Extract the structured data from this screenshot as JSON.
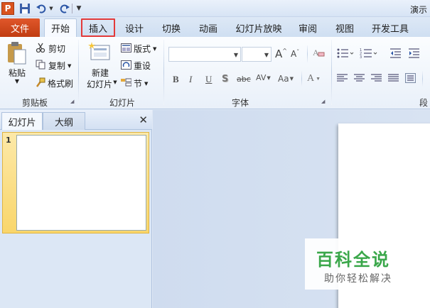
{
  "app": {
    "logo_letter": "P",
    "title": "演示"
  },
  "tabs": [
    {
      "label": "文件"
    },
    {
      "label": "开始"
    },
    {
      "label": "插入"
    },
    {
      "label": "设计"
    },
    {
      "label": "切换"
    },
    {
      "label": "动画"
    },
    {
      "label": "幻灯片放映"
    },
    {
      "label": "审阅"
    },
    {
      "label": "视图"
    },
    {
      "label": "开发工具"
    }
  ],
  "active_tab": "开始",
  "highlighted_tab": "插入",
  "ribbon": {
    "clipboard": {
      "paste": "粘贴",
      "cut": "剪切",
      "copy": "复制",
      "format_painter": "格式刷",
      "group_label": "剪贴板"
    },
    "slides": {
      "new_slide_line1": "新建",
      "new_slide_line2": "幻灯片",
      "layout": "版式",
      "reset": "重设",
      "section": "节",
      "group_label": "幻灯片"
    },
    "font": {
      "font_name": "",
      "font_size": "",
      "grow": "A",
      "shrink": "A",
      "bold": "B",
      "italic": "I",
      "underline": "U",
      "shadow": "S",
      "strike": "abc",
      "spacing": "AV",
      "change_case": "Aa",
      "font_color": "A",
      "group_label": "字体"
    },
    "paragraph": {
      "group_label": "段"
    }
  },
  "pane": {
    "tabs": [
      {
        "label": "幻灯片"
      },
      {
        "label": "大纲"
      }
    ],
    "close": "✕",
    "slide_number": "1"
  },
  "watermark": {
    "logo": "百科全说",
    "subtitle": "助你轻松解决"
  },
  "colors": {
    "file_tab": "#d04a1c",
    "highlight_border": "#e33a3a",
    "thumb_selected": "#f9d66b",
    "watermark_green": "#3aa74a"
  }
}
